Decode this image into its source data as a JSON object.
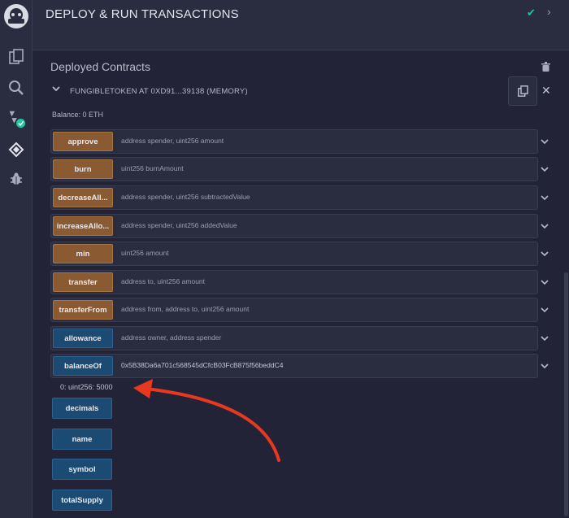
{
  "header": {
    "title": "DEPLOY & RUN TRANSACTIONS"
  },
  "deployed": {
    "title": "Deployed Contracts",
    "contract_name": "FUNGIBLETOKEN AT 0XD91...39138 (MEMORY)",
    "balance": "Balance: 0 ETH"
  },
  "functions": [
    {
      "label": "approve",
      "input": "address spender, uint256 amount"
    },
    {
      "label": "burn",
      "input": "uint256 burnAmount"
    },
    {
      "label": "decreaseAll...",
      "input": "address spender, uint256 subtractedValue"
    },
    {
      "label": "increaseAllo...",
      "input": "address spender, uint256 addedValue"
    },
    {
      "label": "min",
      "input": "uint256 amount"
    },
    {
      "label": "transfer",
      "input": "address to, uint256 amount"
    },
    {
      "label": "transferFrom",
      "input": "address from, address to, uint256 amount"
    },
    {
      "label": "allowance",
      "input": "address owner, address spender"
    },
    {
      "label": "balanceOf",
      "input": "0x5B38Da6a701c568545dCfcB03FcB875f56beddC4"
    }
  ],
  "balance_output": "0: uint256: 5000",
  "calls": [
    {
      "label": "decimals"
    },
    {
      "label": "name"
    },
    {
      "label": "symbol"
    },
    {
      "label": "totalSupply"
    }
  ],
  "colors": {
    "transact_button": "#8a5a32",
    "call_button": "#1b4a73",
    "accent_green": "#1dc9a0",
    "annotation_arrow": "#e8391f"
  },
  "icons": [
    "remix-logo-icon",
    "file-explorer-icon",
    "search-icon",
    "solidity-compiler-icon",
    "deploy-run-icon",
    "debugger-icon",
    "check-icon",
    "chevron-up-icon",
    "trash-icon",
    "caret-down-icon",
    "copy-icon",
    "close-icon",
    "chevron-down-icon"
  ]
}
